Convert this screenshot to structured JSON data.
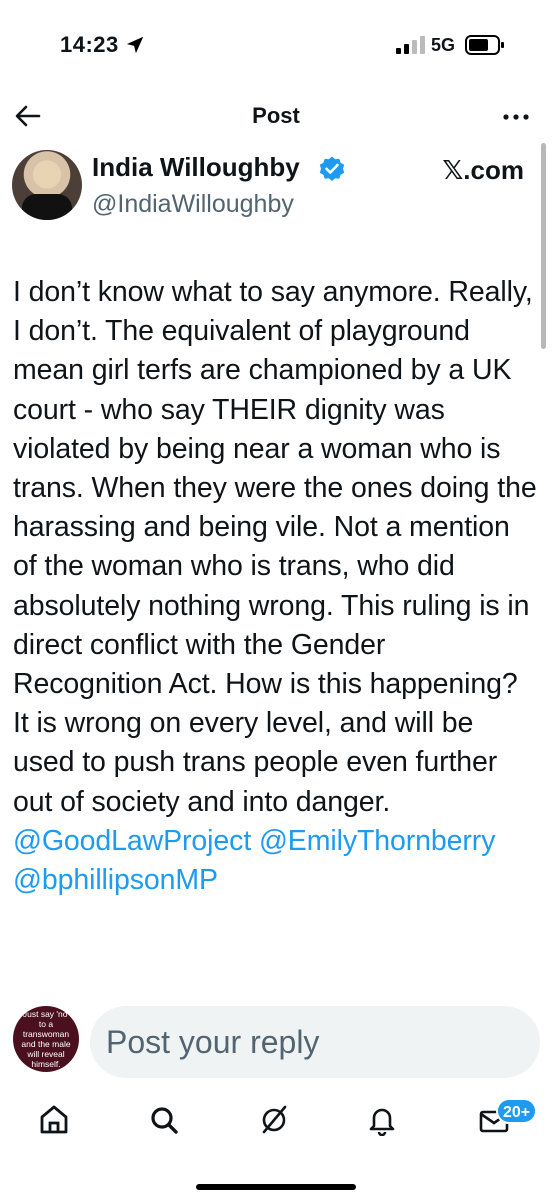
{
  "status_bar": {
    "time": "14:23",
    "network": "5G"
  },
  "header": {
    "title": "Post"
  },
  "author": {
    "name": "India Willoughby",
    "handle": "@IndiaWilloughby",
    "site": "𝕏.com"
  },
  "post": {
    "text": "I don’t know what to say anymore. Really, I don’t. The equivalent of playground mean girl terfs are championed by a UK court - who say THEIR dignity was violated by being near a woman who is trans. When they were the ones doing the harassing and being vile. Not a mention of the woman who is trans, who did absolutely nothing wrong. This ruling is in direct conflict with the Gender Recognition Act. How is this happening? It is wrong on every level, and will be used to push trans people even further out of society and into danger.",
    "mentions": [
      "@GoodLawProject",
      "@EmilyThornberry",
      "@bphillipsonMP"
    ]
  },
  "reply": {
    "avatar_text": "Just say 'no' to a transwoman and the male will reveal himself.",
    "placeholder": "Post your reply"
  },
  "nav": {
    "notifications_badge": "20+"
  },
  "colors": {
    "accent": "#1d9bf0",
    "text": "#0f1419",
    "muted": "#536471"
  }
}
